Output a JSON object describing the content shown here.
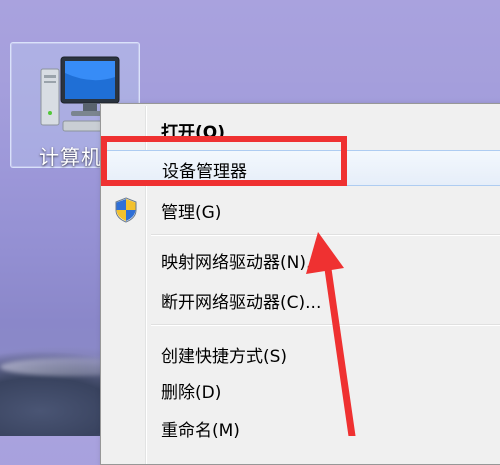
{
  "desktop": {
    "icon_label": "计算机",
    "icon_name": "computer-icon"
  },
  "context_menu": {
    "items": [
      {
        "label": "打开(O)",
        "bold": true
      },
      {
        "label": "设备管理器",
        "highlighted": true
      },
      {
        "label": "管理(G)",
        "icon": "shield-icon"
      },
      {
        "label": "映射网络驱动器(N)..."
      },
      {
        "label": "断开网络驱动器(C)..."
      },
      {
        "label": "创建快捷方式(S)"
      },
      {
        "label": "删除(D)"
      },
      {
        "label": "重命名(M)"
      }
    ]
  },
  "annotation": {
    "color": "#ef3131",
    "target": "设备管理器"
  }
}
